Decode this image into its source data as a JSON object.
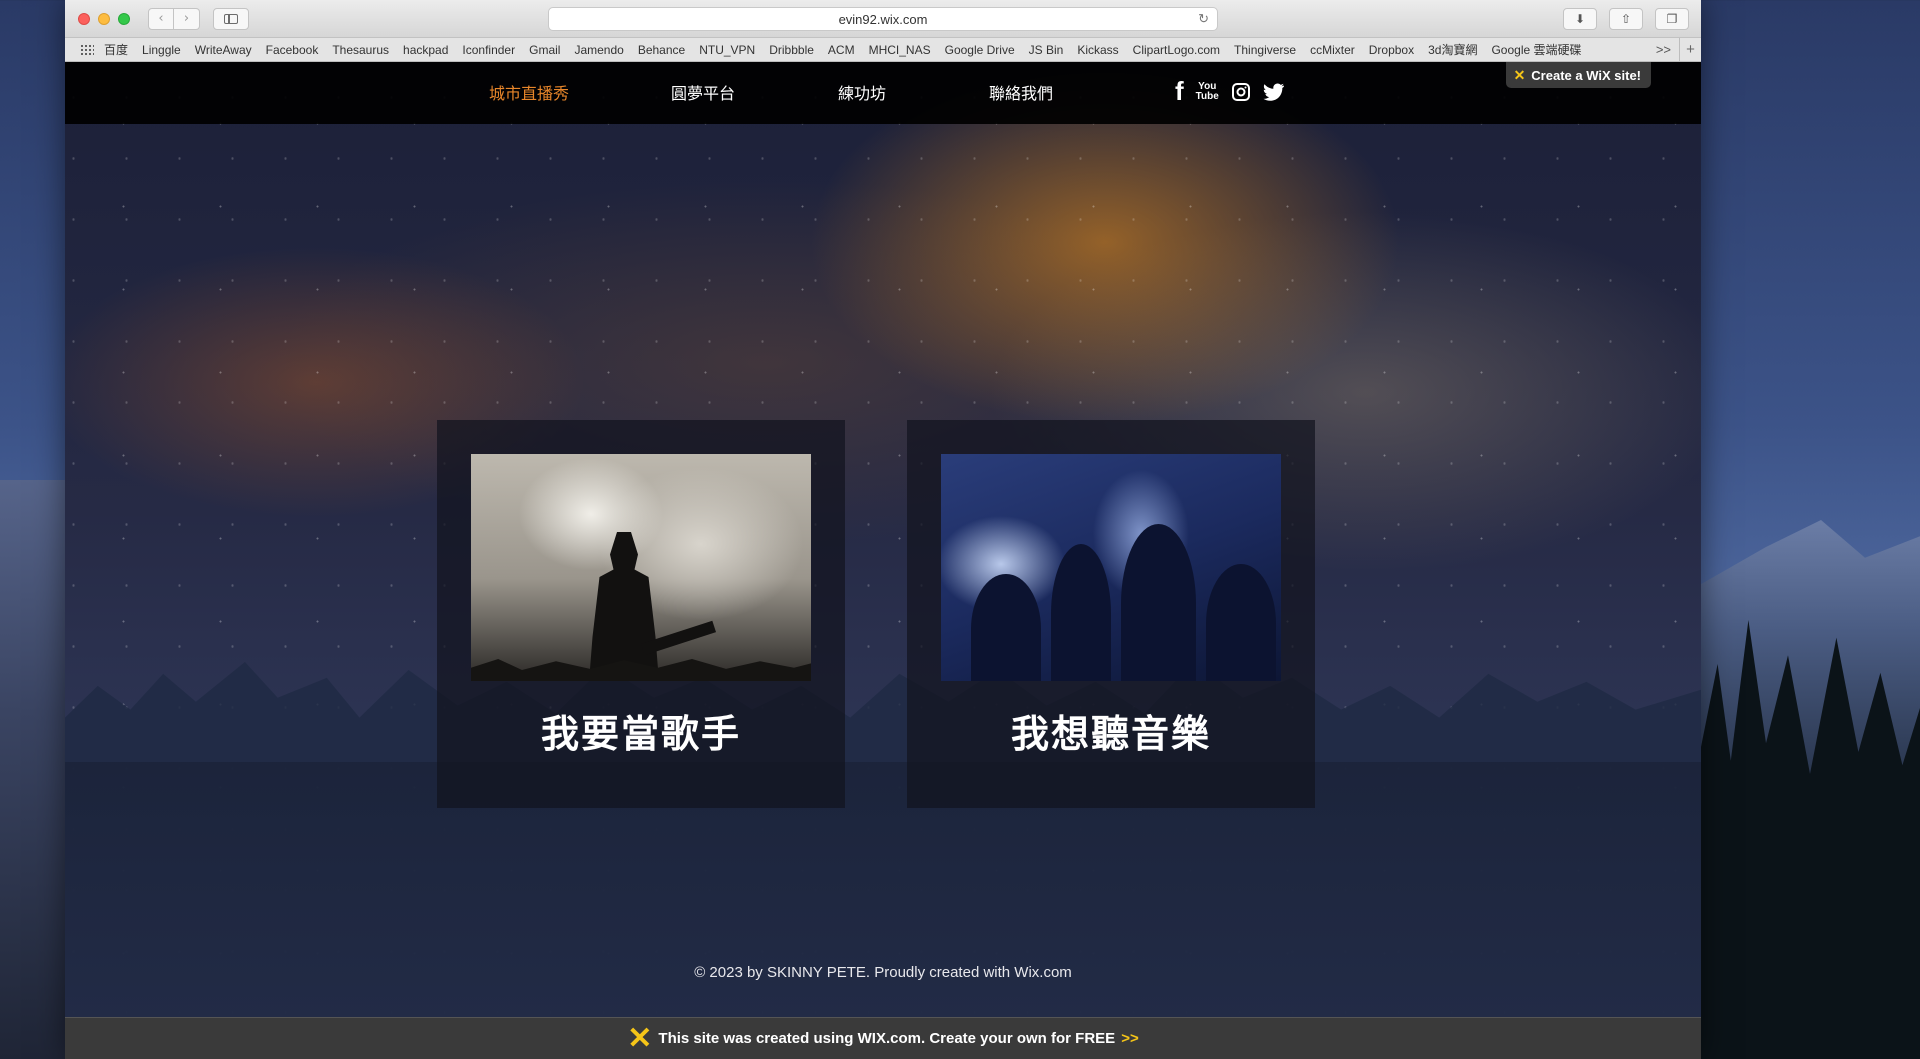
{
  "browser": {
    "url": "evin92.wix.com",
    "bookmarks": [
      "百度",
      "Linggle",
      "WriteAway",
      "Facebook",
      "Thesaurus",
      "hackpad",
      "Iconfinder",
      "Gmail",
      "Jamendo",
      "Behance",
      "NTU_VPN",
      "Dribbble",
      "ACM",
      "MHCI_NAS",
      "Google Drive",
      "JS Bin",
      "Kickass",
      "ClipartLogo.com",
      "Thingiverse",
      "ccMixter",
      "Dropbox",
      "3d淘寶網",
      "Google 雲端硬碟"
    ],
    "more": ">>",
    "plus": "+"
  },
  "site": {
    "nav": [
      "城市直播秀",
      "圓夢平台",
      "練功坊",
      "聯絡我們"
    ],
    "social": [
      "facebook",
      "youtube",
      "instagram",
      "twitter"
    ],
    "wix_create": "Create a WiX site!",
    "cards": [
      {
        "title": "我要當歌手",
        "image": "guitarist silhouette on stage"
      },
      {
        "title": "我想聽音樂",
        "image": "cheering concert crowd"
      }
    ],
    "footer": "© 2023 by SKINNY PETE. Proudly created with Wix.com",
    "wix_banner": "This site was created using WIX.com. Create your own for FREE",
    "wix_banner_arrows": ">>"
  },
  "colors": {
    "nav_active": "#e8862a",
    "wix_yellow": "#f5c518"
  }
}
